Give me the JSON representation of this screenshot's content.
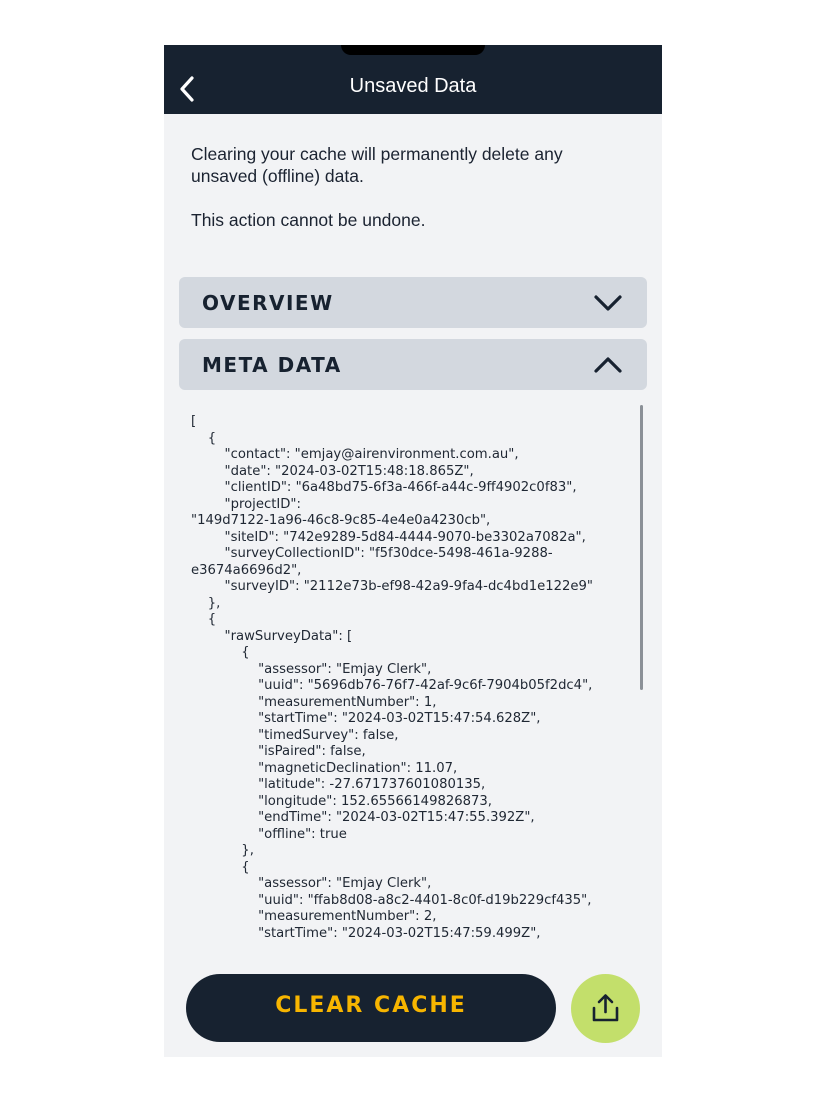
{
  "header": {
    "title": "Unsaved Data"
  },
  "intro": {
    "line1": "Clearing your cache will permanently delete any unsaved (offline) data.",
    "line2": "This action cannot be undone."
  },
  "accordions": [
    {
      "label": "OVERVIEW",
      "state": "collapsed"
    },
    {
      "label": "META DATA",
      "state": "expanded"
    }
  ],
  "metadata_text": "[\n    {\n        \"contact\": \"emjay@airenvironment.com.au\",\n        \"date\": \"2024-03-02T15:48:18.865Z\",\n        \"clientID\": \"6a48bd75-6f3a-466f-a44c-9ff4902c0f83\",\n        \"projectID\":\n\"149d7122-1a96-46c8-9c85-4e4e0a4230cb\",\n        \"siteID\": \"742e9289-5d84-4444-9070-be3302a7082a\",\n        \"surveyCollectionID\": \"f5f30dce-5498-461a-9288-\ne3674a6696d2\",\n        \"surveyID\": \"2112e73b-ef98-42a9-9fa4-dc4bd1e122e9\"\n    },\n    {\n        \"rawSurveyData\": [\n            {\n                \"assessor\": \"Emjay Clerk\",\n                \"uuid\": \"5696db76-76f7-42af-9c6f-7904b05f2dc4\",\n                \"measurementNumber\": 1,\n                \"startTime\": \"2024-03-02T15:47:54.628Z\",\n                \"timedSurvey\": false,\n                \"isPaired\": false,\n                \"magneticDeclination\": 11.07,\n                \"latitude\": -27.671737601080135,\n                \"longitude\": 152.65566149826873,\n                \"endTime\": \"2024-03-02T15:47:55.392Z\",\n                \"offline\": true\n            },\n            {\n                \"assessor\": \"Emjay Clerk\",\n                \"uuid\": \"ffab8d08-a8c2-4401-8c0f-d19b229cf435\",\n                \"measurementNumber\": 2,\n                \"startTime\": \"2024-03-02T15:47:59.499Z\",",
  "actions": {
    "clear_label": "CLEAR CACHE"
  },
  "icons": {
    "back": "chevron-left-icon",
    "overview": "chevron-down-icon",
    "meta": "chevron-up-icon",
    "share": "share-upload-icon"
  },
  "colors": {
    "header": "#172230",
    "accent": "#f7b500",
    "share": "#c3df6b",
    "accordion": "#d3d8df"
  }
}
